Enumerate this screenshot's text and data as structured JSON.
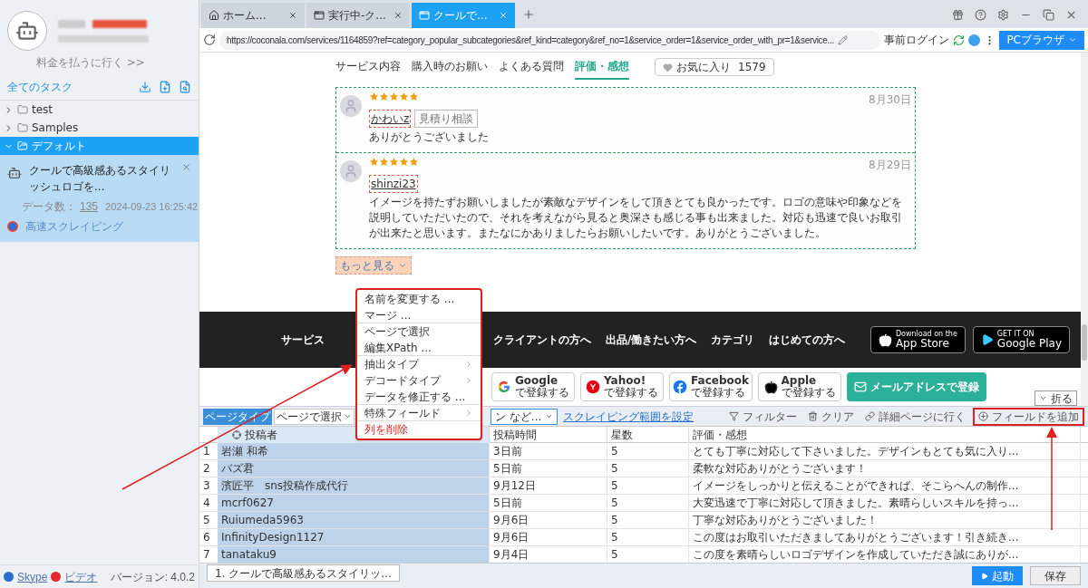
{
  "sidebar": {
    "pay_link": "料金を払うに行く >>",
    "all_tasks": "全てのタスク",
    "tree": [
      {
        "label": "test",
        "expanded": false,
        "selected": false
      },
      {
        "label": "Samples",
        "expanded": false,
        "selected": false
      },
      {
        "label": "デフォルト",
        "expanded": true,
        "selected": true,
        "tasks": [
          {
            "title": "クールで高級感あるスタイリッシュロゴを...",
            "count_label": "データ数：",
            "count": "135",
            "timestamp": "2024-09-23 16:25:42",
            "mode": "高速スクレイピング"
          }
        ]
      }
    ],
    "links": [
      {
        "kind": "skype",
        "label": "Skype"
      },
      {
        "kind": "video",
        "label": "ビデオ"
      }
    ],
    "version": "バージョン: 4.0.2"
  },
  "browser": {
    "tabs": [
      {
        "kind": "home",
        "label": "ホーム...",
        "selected": false
      },
      {
        "kind": "page",
        "label": "実行中-ク...",
        "selected": false
      },
      {
        "kind": "page",
        "label": "クールで...",
        "selected": true
      }
    ],
    "url": "https://coconala.com/services/1164859?ref=category_popular_subcategories&ref_kind=category&ref_no=1&service_order=1&service_order_with_pr=1&service...",
    "pre_login": "事前ログイン",
    "mode_button": "PCブラウザ"
  },
  "page": {
    "nav": [
      {
        "label": "サービス内容",
        "selected": false
      },
      {
        "label": "購入時のお願い",
        "selected": false
      },
      {
        "label": "よくある質問",
        "selected": false
      },
      {
        "label": "評価・感想",
        "selected": true
      }
    ],
    "favorite": {
      "label": "お気に入り",
      "count": "1579"
    },
    "reviews": [
      {
        "stars": 5,
        "user": "かわいz",
        "tag": "見積り相談",
        "date": "8月30日",
        "text": "ありがとうございました"
      },
      {
        "stars": 5,
        "user": "shinzi23",
        "date": "8月29日",
        "text": "イメージを持たずお願いしましたが素敵なデザインをして頂きとても良かったです。ロゴの意味や印象などを説明していただいたので、それを考えながら見ると奥深さも感じる事も出来ました。対応も迅速で良いお取引が出来たと思います。またなにかありましたらお願いしたいです。ありがとうございました。"
      }
    ],
    "more": "もっと見る",
    "footer_headings": [
      "サービス",
      "クライアントの方へ",
      "出品/働きたい方へ",
      "カテゴリ",
      "はじめての方へ"
    ],
    "store_badges": [
      {
        "kind": "apple",
        "small": "Download on the",
        "label": "App Store"
      },
      {
        "kind": "google",
        "small": "GET IT ON",
        "label": "Google Play"
      }
    ],
    "login_buttons": [
      {
        "kind": "google",
        "name": "Google",
        "action": "で登録する"
      },
      {
        "kind": "yahoo",
        "name": "Yahoo!",
        "action": "で登録する"
      },
      {
        "kind": "facebook",
        "name": "Facebook",
        "action": "で登録する"
      },
      {
        "kind": "apple",
        "name": "Apple",
        "action": "で登録する"
      }
    ],
    "email_button": "メールアドレスで登録",
    "collapse": "折る"
  },
  "toolbar": {
    "page_type": "ページタイプ",
    "page_select": "ページで選択",
    "second_select": "ン など...",
    "range_link": "スクレイピング範囲を設定",
    "actions": [
      {
        "kind": "filter",
        "label": "フィルター",
        "highlighted": false
      },
      {
        "kind": "clear",
        "label": "クリア",
        "highlighted": false
      },
      {
        "kind": "link",
        "label": "詳細ページに行く",
        "highlighted": false
      },
      {
        "kind": "add",
        "label": "フィールドを追加",
        "highlighted": true
      }
    ]
  },
  "table": {
    "columns": [
      {
        "label": "投稿者",
        "selected": true
      },
      {
        "label": "投稿時間",
        "selected": false
      },
      {
        "label": "星数",
        "selected": false
      },
      {
        "label": "評価・感想",
        "selected": false
      }
    ],
    "rows": [
      {
        "index": "1",
        "cells": [
          "岩瀬 和希",
          "3日前",
          "5",
          "とても丁寧に対応して下さいました。デザインもとても気に入り..."
        ]
      },
      {
        "index": "2",
        "cells": [
          "バズ君",
          "5日前",
          "5",
          "柔軟な対応ありがとうございます！"
        ]
      },
      {
        "index": "3",
        "cells": [
          "濱匠平　sns投稿作成代行",
          "9月12日",
          "5",
          "イメージをしっかりと伝えることができれば、そこらへんの制作..."
        ]
      },
      {
        "index": "4",
        "cells": [
          "mcrf0627",
          "5日前",
          "5",
          "大変迅速で丁寧に対応して頂きました。素晴らしいスキルを持っ..."
        ]
      },
      {
        "index": "5",
        "cells": [
          "Ruiumeda5963",
          "9月6日",
          "5",
          "丁寧な対応ありがとうございました！"
        ]
      },
      {
        "index": "6",
        "cells": [
          "InfinityDesign1127",
          "9月6日",
          "5",
          "この度はお取引いただきましてありがとうございます！引き続き..."
        ]
      },
      {
        "index": "7",
        "cells": [
          "tanataku9",
          "9月4日",
          "5",
          "この度を素晴らしいロゴデザインを作成していただき誠にありが..."
        ]
      }
    ]
  },
  "context_menu": [
    {
      "label": "名前を変更する ...",
      "kind": "normal",
      "submenu": false,
      "separator": false
    },
    {
      "label": "マージ ...",
      "kind": "normal",
      "submenu": false,
      "separator": true
    },
    {
      "label": "ページで選択",
      "kind": "normal",
      "submenu": false,
      "separator": false
    },
    {
      "label": "編集XPath ...",
      "kind": "normal",
      "submenu": false,
      "separator": true
    },
    {
      "label": "抽出タイプ",
      "kind": "normal",
      "submenu": true,
      "separator": false
    },
    {
      "label": "デコードタイプ",
      "kind": "normal",
      "submenu": true,
      "separator": false
    },
    {
      "label": "データを修正する ...",
      "kind": "normal",
      "submenu": false,
      "separator": true
    },
    {
      "label": "特殊フィールド",
      "kind": "normal",
      "submenu": true,
      "separator": true
    },
    {
      "label": "列を削除",
      "kind": "danger",
      "submenu": false,
      "separator": false
    }
  ],
  "bottom": {
    "task_tab": "1. クールで高級感あるスタイリッ...",
    "start": "起動",
    "save": "保存"
  }
}
